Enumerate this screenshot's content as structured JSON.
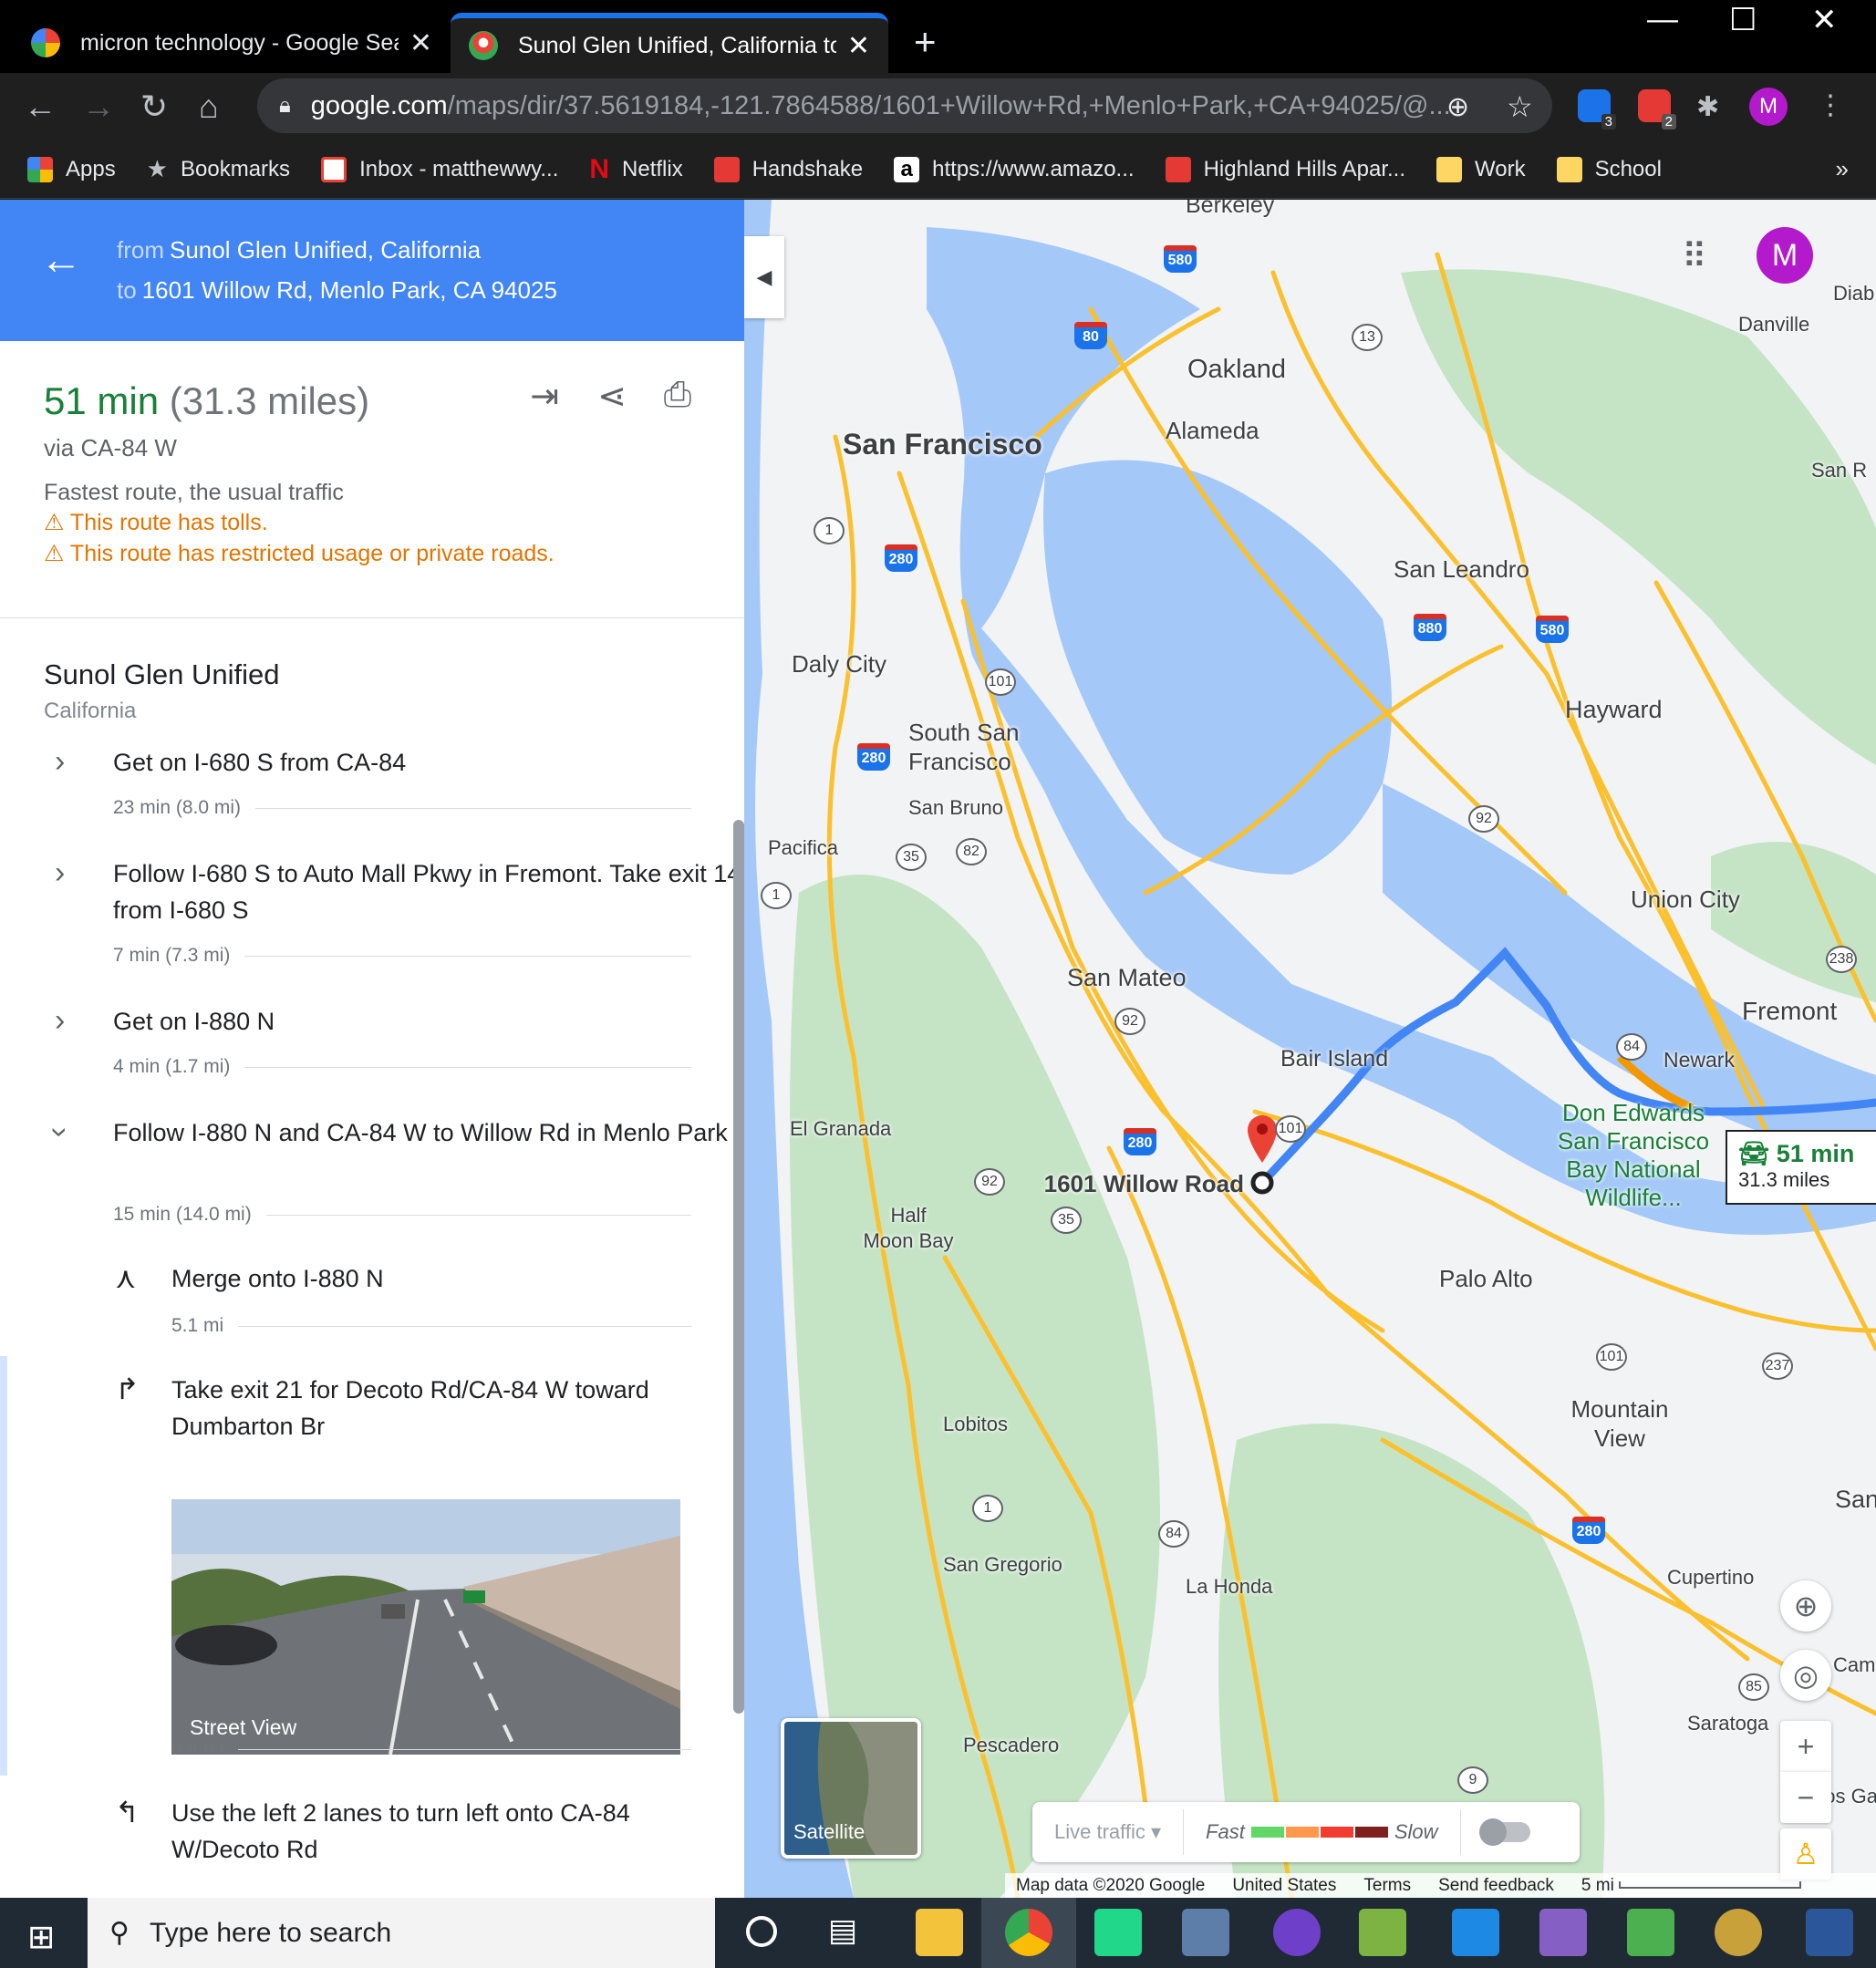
{
  "browser": {
    "tabs": [
      {
        "title": "micron technology - Google Sear",
        "active": false
      },
      {
        "title": "Sunol Glen Unified, California to",
        "active": true
      }
    ],
    "url_domain": "google.com",
    "url_path": "/maps/dir/37.5619184,-121.7864588/1601+Willow+Rd,+Menlo+Park,+CA+94025/@...",
    "ext_badges": [
      "3",
      "2"
    ],
    "profile_initial": "M",
    "bookmarks": [
      "Apps",
      "Bookmarks",
      "Inbox - matthewwy...",
      "Netflix",
      "Handshake",
      "https://www.amazo...",
      "Highland Hills Apar...",
      "Work",
      "School"
    ]
  },
  "directions": {
    "from_label": "from",
    "from": "Sunol Glen Unified, California",
    "to_label": "to",
    "to": "1601 Willow Rd, Menlo Park, CA 94025",
    "duration": "51 min",
    "distance": "(31.3 miles)",
    "via": "via CA-84 W",
    "traffic_note": "Fastest route, the usual traffic",
    "warnings": [
      "This route has tolls.",
      "This route has restricted usage or private roads."
    ],
    "origin_name": "Sunol Glen Unified",
    "origin_sub": "California",
    "steps": [
      {
        "text": "Get on I-680 S from CA-84",
        "dist": "23 min (8.0 mi)"
      },
      {
        "text": "Follow I-680 S to Auto Mall Pkwy in Fremont. Take exit 14 from I-680 S",
        "dist": "7 min (7.3 mi)"
      },
      {
        "text": "Get on I-880 N",
        "dist": "4 min (1.7 mi)"
      },
      {
        "text": "Follow I-880 N and CA-84 W to Willow Rd in Menlo Park",
        "dist": "15 min (14.0 mi)"
      }
    ],
    "substeps": [
      {
        "text": "Merge onto I-880 N",
        "dist": "5.1 mi"
      },
      {
        "text": "Take exit 21 for Decoto Rd/CA-84 W toward Dumbarton Br",
        "dist": "0.4 mi"
      },
      {
        "text": "Use the left 2 lanes to turn left onto CA-84 W/Decoto Rd",
        "dist": ""
      }
    ],
    "street_view_label": "Street View"
  },
  "map": {
    "places": [
      "Berkeley",
      "Oakland",
      "Alameda",
      "San Francisco",
      "San Leandro",
      "Daly City",
      "Hayward",
      "South San Francisco",
      "San Bruno",
      "Pacifica",
      "Union City",
      "San Mateo",
      "Fremont",
      "Newark",
      "Bair Island",
      "El Granada",
      "Don Edwards San Francisco Bay National Wildlife...",
      "1601 Willow Road",
      "Half Moon Bay",
      "Palo Alto",
      "Mountain View",
      "Lobitos",
      "Santa",
      "San Gregorio",
      "La Honda",
      "Cupertino",
      "Saratoga",
      "Pescadero",
      "Danville",
      "San R",
      "Diab",
      "Cam",
      "Los Ga"
    ],
    "route_time": "51 min",
    "route_distance": "31.3 miles",
    "satellite_label": "Satellite",
    "live_traffic": "Live traffic",
    "fast": "Fast",
    "slow": "Slow",
    "footer": [
      "Map data ©2020 Google",
      "United States",
      "Terms",
      "Send feedback",
      "5 mi"
    ],
    "colors": {
      "water": "#a4c8f8",
      "land": "#f1f3f4",
      "park": "#c5e4c5",
      "highway": "#fbc02d",
      "route": "#4285f4"
    }
  },
  "taskbar": {
    "search_placeholder": "Type here to search"
  }
}
